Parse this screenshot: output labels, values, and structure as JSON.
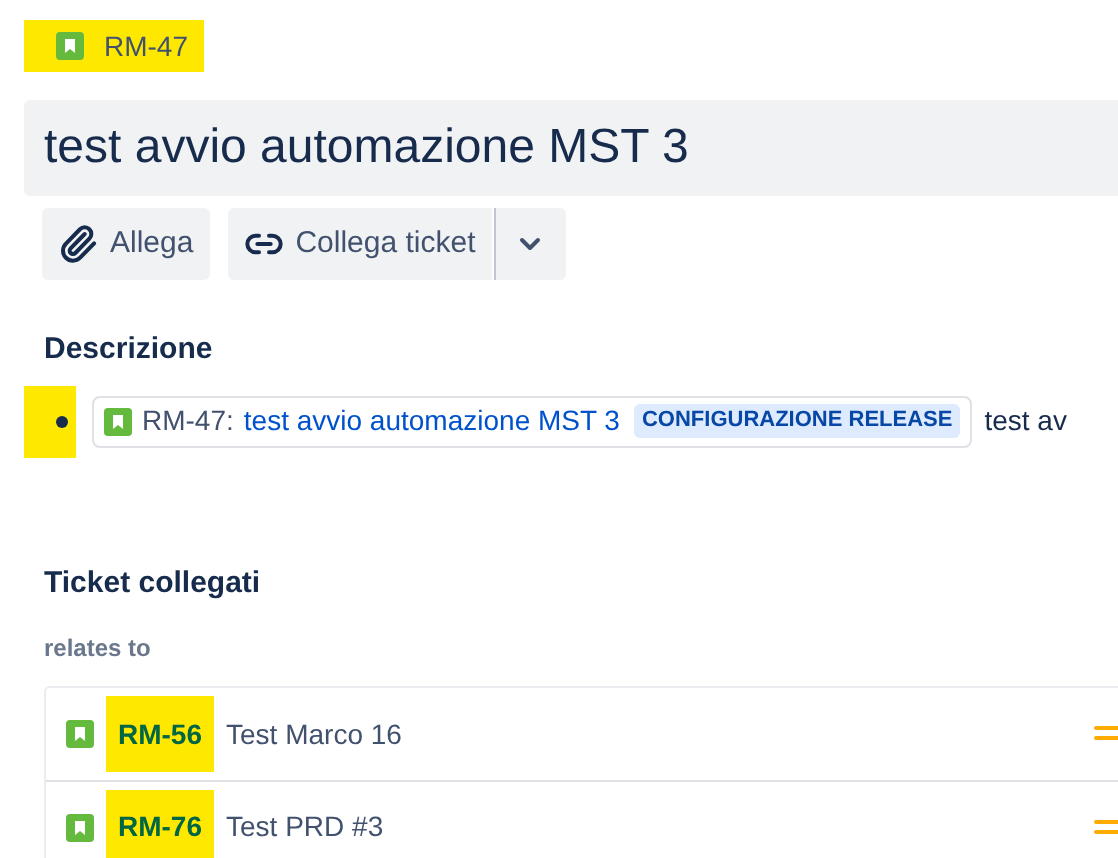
{
  "issue": {
    "key": "RM-47",
    "highlighted": true
  },
  "title": "test avvio automazione MST 3",
  "actions": [
    {
      "kind": "attach",
      "label": "Allega"
    },
    {
      "kind": "link",
      "label": "Collega ticket"
    }
  ],
  "description": {
    "heading": "Descrizione",
    "bullet": {
      "key": "RM-47:",
      "summary": "test avvio automazione MST 3",
      "status": "CONFIGURAZIONE RELEASE",
      "trailing": "test av",
      "highlighted": true
    }
  },
  "linked": {
    "heading": "Ticket collegati",
    "relation": "relates to",
    "items": [
      {
        "key": "RM-56",
        "summary": "Test Marco 16",
        "highlighted": true
      },
      {
        "key": "RM-76",
        "summary": "Test PRD #3",
        "highlighted": true
      }
    ]
  }
}
